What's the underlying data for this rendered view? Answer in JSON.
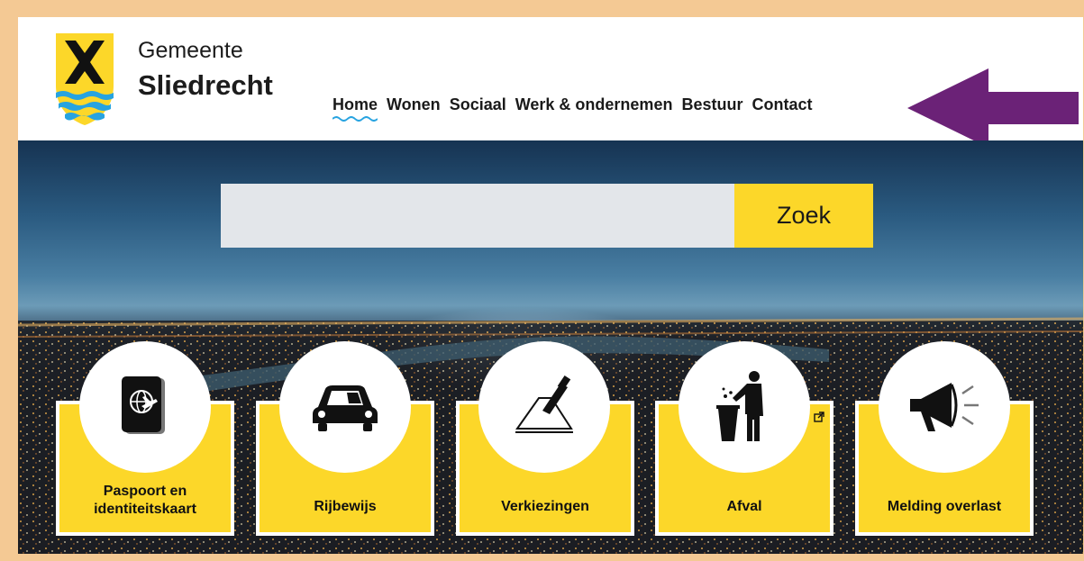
{
  "brand": {
    "line1": "Gemeente",
    "line2": "Sliedrecht"
  },
  "nav": {
    "items": [
      {
        "label": "Home",
        "active": true
      },
      {
        "label": "Wonen"
      },
      {
        "label": "Sociaal"
      },
      {
        "label": "Werk & ondernemen"
      },
      {
        "label": "Bestuur"
      },
      {
        "label": "Contact"
      }
    ]
  },
  "search": {
    "button_label": "Zoek",
    "value": ""
  },
  "tiles": [
    {
      "label": "Paspoort en identiteitskaart",
      "icon": "passport-icon"
    },
    {
      "label": "Rijbewijs",
      "icon": "car-icon"
    },
    {
      "label": "Verkiezingen",
      "icon": "ballot-icon"
    },
    {
      "label": "Afval",
      "icon": "trash-bin-icon",
      "external": true
    },
    {
      "label": "Melding overlast",
      "icon": "megaphone-icon"
    }
  ],
  "colors": {
    "accent_yellow": "#fcd729",
    "annotation_arrow": "#6b2277",
    "frame_border": "#f4c994",
    "wave_blue": "#27a3e0"
  }
}
